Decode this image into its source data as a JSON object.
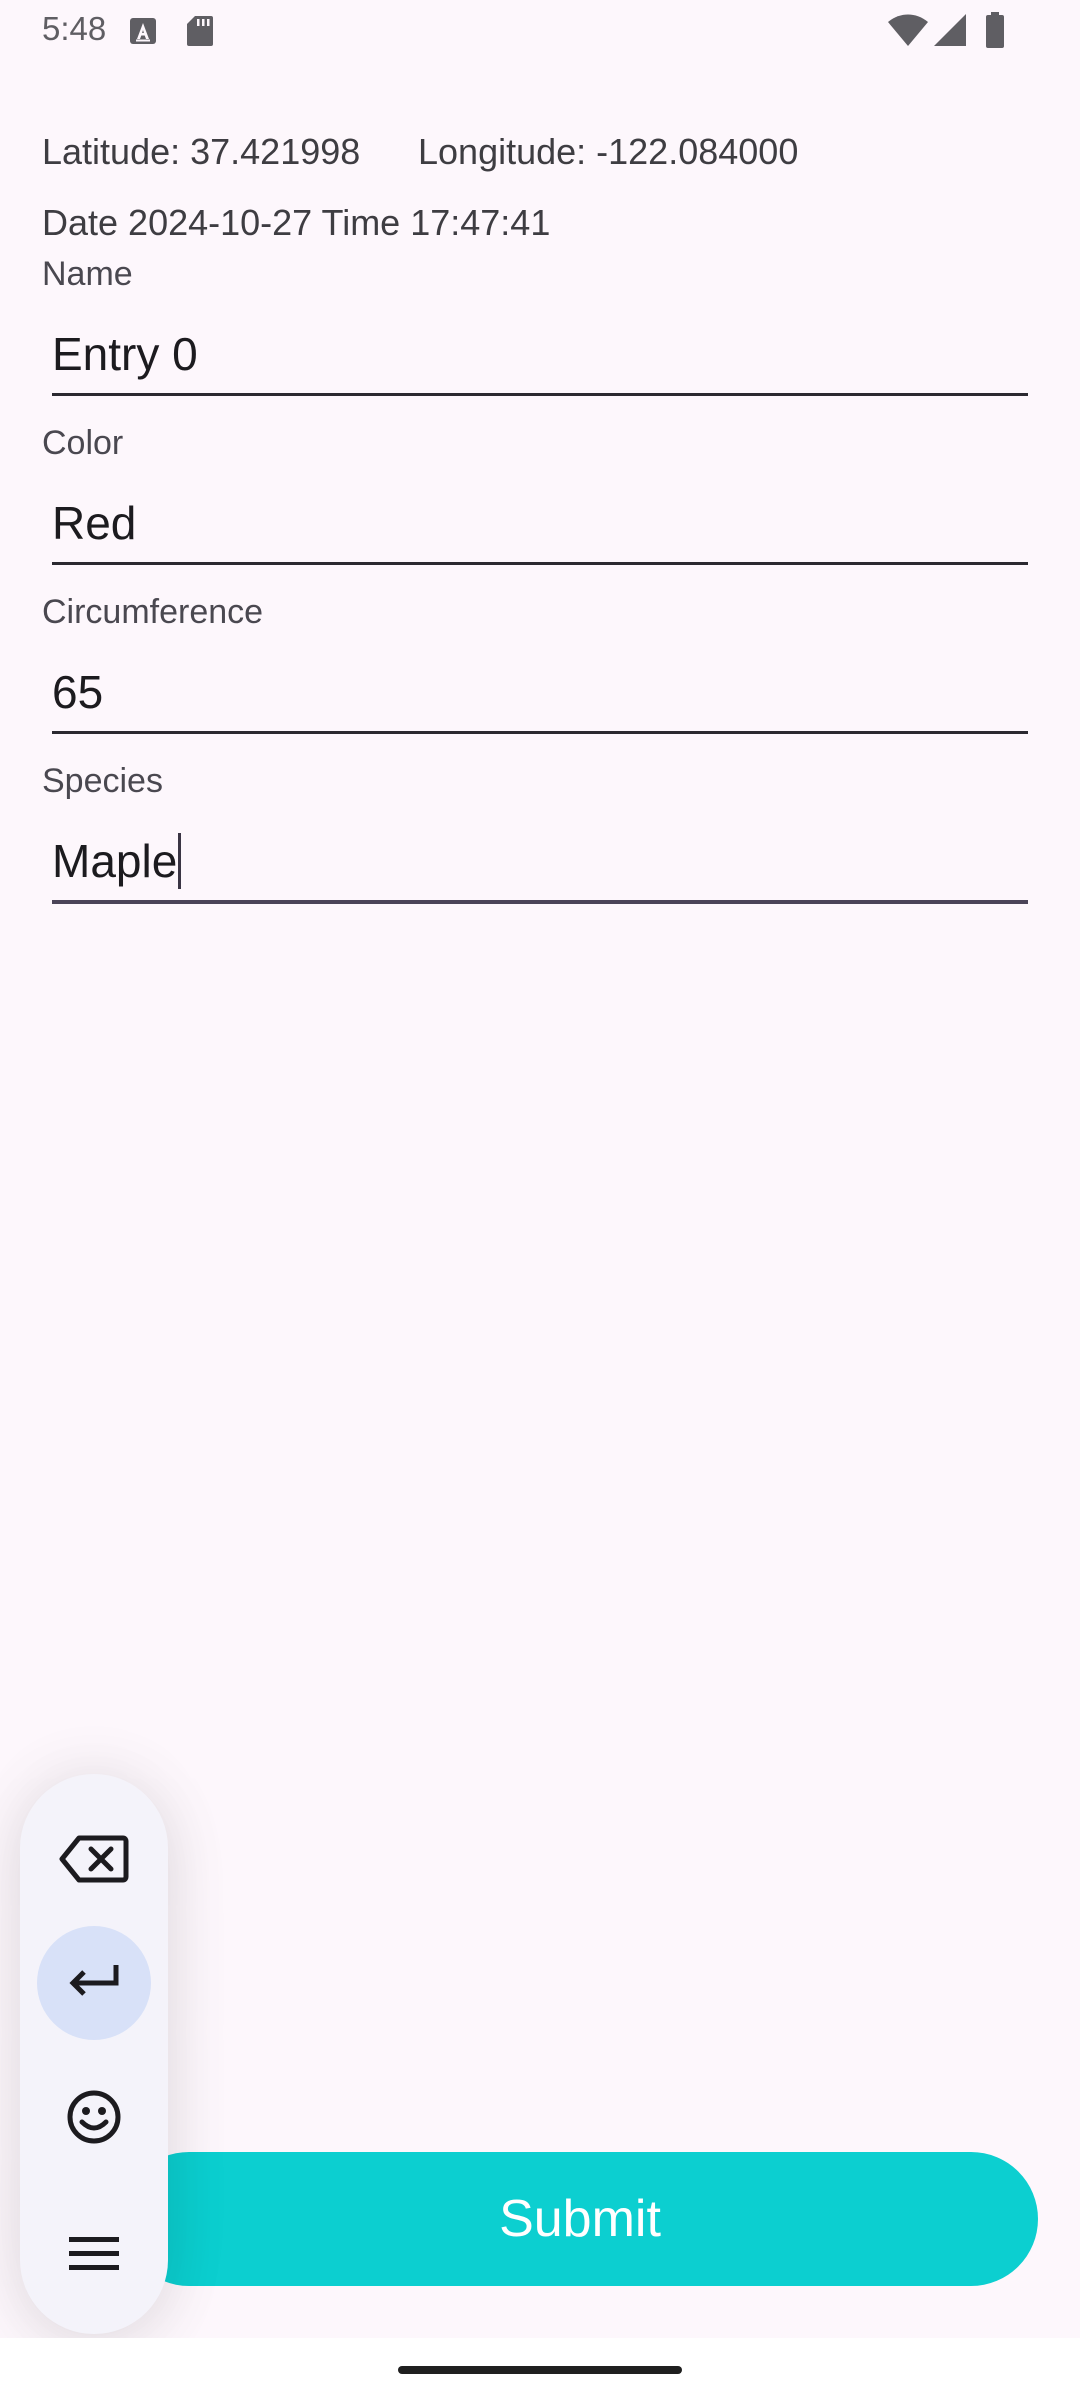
{
  "status_bar": {
    "time": "5:48",
    "icons": [
      "accessibility-a-icon",
      "sd-card-icon",
      "wifi-icon",
      "cell-signal-icon",
      "battery-icon"
    ]
  },
  "location": {
    "latitude": "Latitude: 37.421998",
    "longitude": "Longitude: -122.084000"
  },
  "datetime": "Date 2024-10-27 Time 17:47:41",
  "form": {
    "name": {
      "label": "Name",
      "value": "Entry 0"
    },
    "color": {
      "label": "Color",
      "value": "Red"
    },
    "circumference": {
      "label": "Circumference",
      "value": "65"
    },
    "species": {
      "label": "Species",
      "value": "Maple"
    }
  },
  "submit_label": "Submit",
  "keyboard_toolbar": {
    "buttons": [
      "backspace-icon",
      "enter-icon",
      "emoji-icon",
      "menu-icon"
    ]
  },
  "colors": {
    "background": "#fdf7fc",
    "accent": "#0ccfd0",
    "toolbar_active": "#d8e1f8"
  }
}
